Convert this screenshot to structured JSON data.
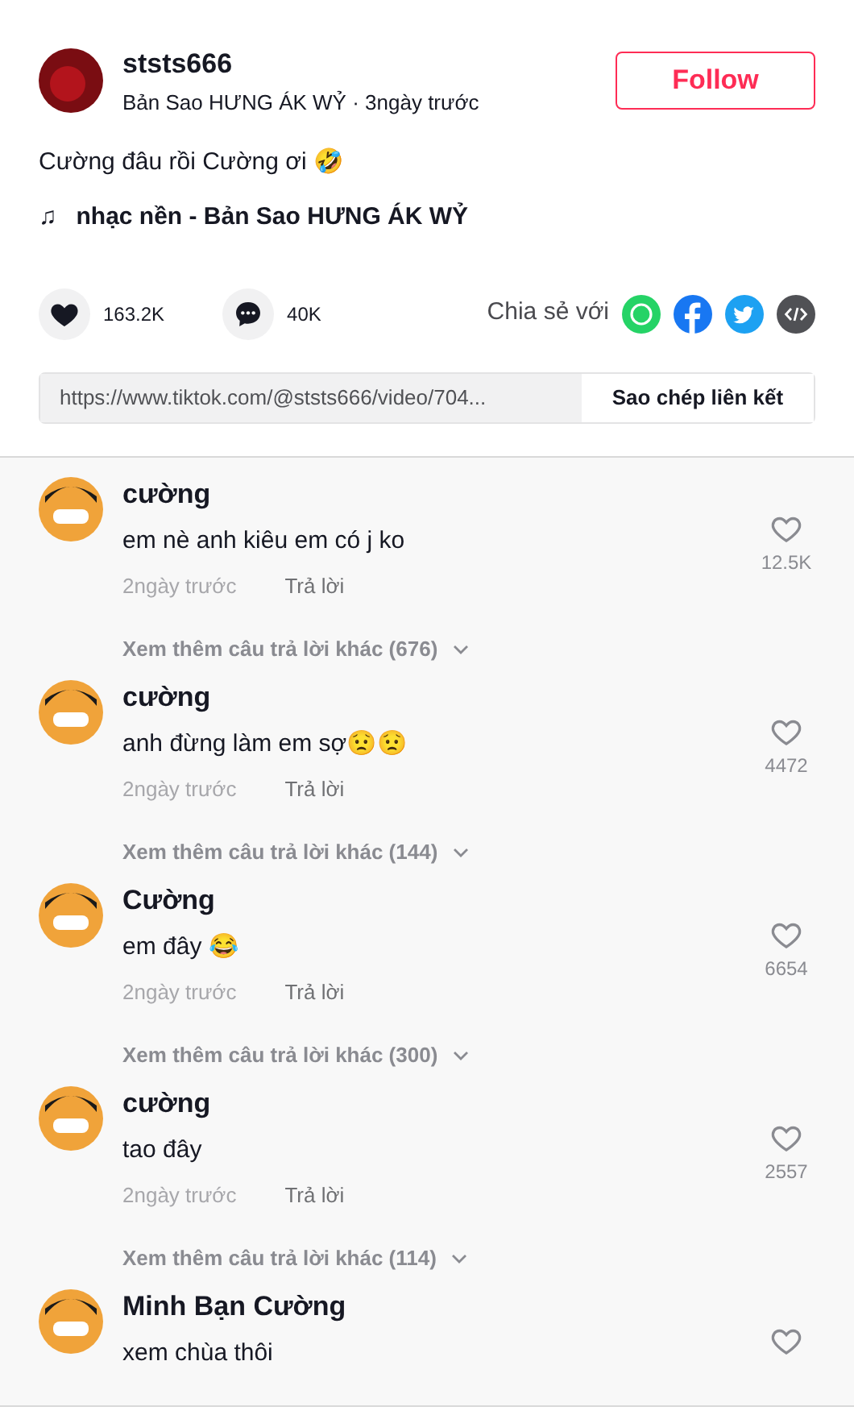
{
  "author": {
    "username": "ststs666",
    "subtitle": "Bản Sao HƯNG ÁK WỶ · 3ngày trước",
    "follow": "Follow"
  },
  "caption": "Cường đâu rồi Cường ơi 🤣",
  "music": {
    "icon": "♫",
    "title": "nhạc nền - Bản Sao HƯNG ÁK WỶ"
  },
  "stats": {
    "likes": "163.2K",
    "comments": "40K",
    "share_label": "Chia sẻ với"
  },
  "link": {
    "url": "https://www.tiktok.com/@ststs666/video/704...",
    "copy": "Sao chép liên kết"
  },
  "comments": [
    {
      "user": "cường",
      "text": "em nè anh kiêu em có j ko",
      "time": "2ngày trước",
      "reply": "Trả lời",
      "likes": "12.5K",
      "more": "Xem thêm câu trả lời khác (676)"
    },
    {
      "user": "cường",
      "text": "anh đừng làm em sợ😟😟",
      "time": "2ngày trước",
      "reply": "Trả lời",
      "likes": "4472",
      "more": "Xem thêm câu trả lời khác (144)"
    },
    {
      "user": "Cường",
      "text": "em đây 😂",
      "time": "2ngày trước",
      "reply": "Trả lời",
      "likes": "6654",
      "more": "Xem thêm câu trả lời khác (300)"
    },
    {
      "user": "cường",
      "text": "tao đây",
      "time": "2ngày trước",
      "reply": "Trả lời",
      "likes": "2557",
      "more": "Xem thêm câu trả lời khác (114)"
    },
    {
      "user": "Minh Bạn Cường",
      "text": "xem chùa thôi"
    }
  ]
}
